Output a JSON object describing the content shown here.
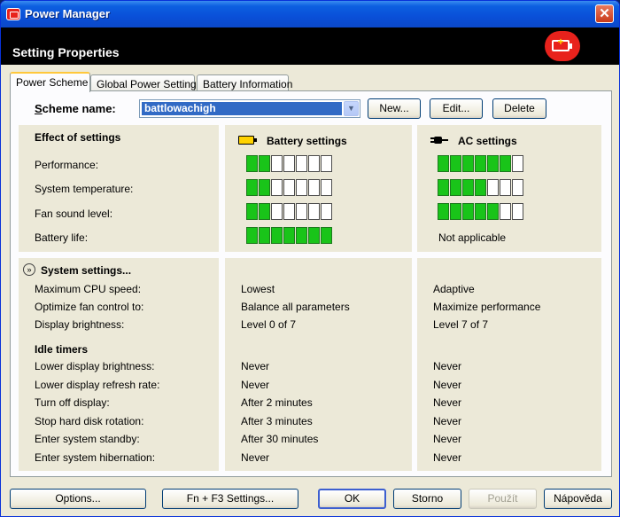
{
  "window": {
    "title": "Power Manager"
  },
  "header": {
    "title": "Setting Properties"
  },
  "tabs": [
    {
      "label": "Power Scheme"
    },
    {
      "label": "Global Power Settings"
    },
    {
      "label": "Battery Information"
    }
  ],
  "scheme": {
    "label_underlined": "S",
    "label_rest": "cheme name:",
    "value": "battlowachigh",
    "buttons": {
      "new": "New...",
      "edit": "Edit...",
      "delete": "Delete"
    }
  },
  "effects": {
    "title": "Effect of settings",
    "battery_header": "Battery settings",
    "ac_header": "AC settings",
    "rows": [
      {
        "label": "Performance:",
        "battery_level": 2,
        "ac_level": 6,
        "max": 7
      },
      {
        "label": "System temperature:",
        "battery_level": 2,
        "ac_level": 4,
        "max": 7
      },
      {
        "label": "Fan sound level:",
        "battery_level": 2,
        "ac_level": 5,
        "max": 7
      },
      {
        "label": "Battery life:",
        "battery_level": 7,
        "ac_text": "Not applicable",
        "max": 7
      }
    ]
  },
  "system_settings": {
    "title": "System settings...",
    "rows": [
      {
        "label": "Maximum CPU speed:",
        "battery": "Lowest",
        "ac": "Adaptive"
      },
      {
        "label": "Optimize fan control to:",
        "battery": "Balance all parameters",
        "ac": "Maximize performance"
      },
      {
        "label": "Display brightness:",
        "battery": "Level 0 of 7",
        "ac": "Level 7 of 7"
      }
    ],
    "idle_title": "Idle timers",
    "idle_rows": [
      {
        "label": "Lower display brightness:",
        "battery": "Never",
        "ac": "Never"
      },
      {
        "label": "Lower display refresh rate:",
        "battery": "Never",
        "ac": "Never"
      },
      {
        "label": "Turn off display:",
        "battery": "After 2 minutes",
        "ac": "Never"
      },
      {
        "label": "Stop hard disk rotation:",
        "battery": "After 3 minutes",
        "ac": "Never"
      },
      {
        "label": "Enter system standby:",
        "battery": "After 30 minutes",
        "ac": "Never"
      },
      {
        "label": "Enter system hibernation:",
        "battery": "Never",
        "ac": "Never"
      }
    ]
  },
  "footer": {
    "options": "Options...",
    "fn_f3": "Fn + F3 Settings...",
    "ok": "OK",
    "storno": "Storno",
    "pouzit": "Použít",
    "napoveda": "Nápověda"
  }
}
